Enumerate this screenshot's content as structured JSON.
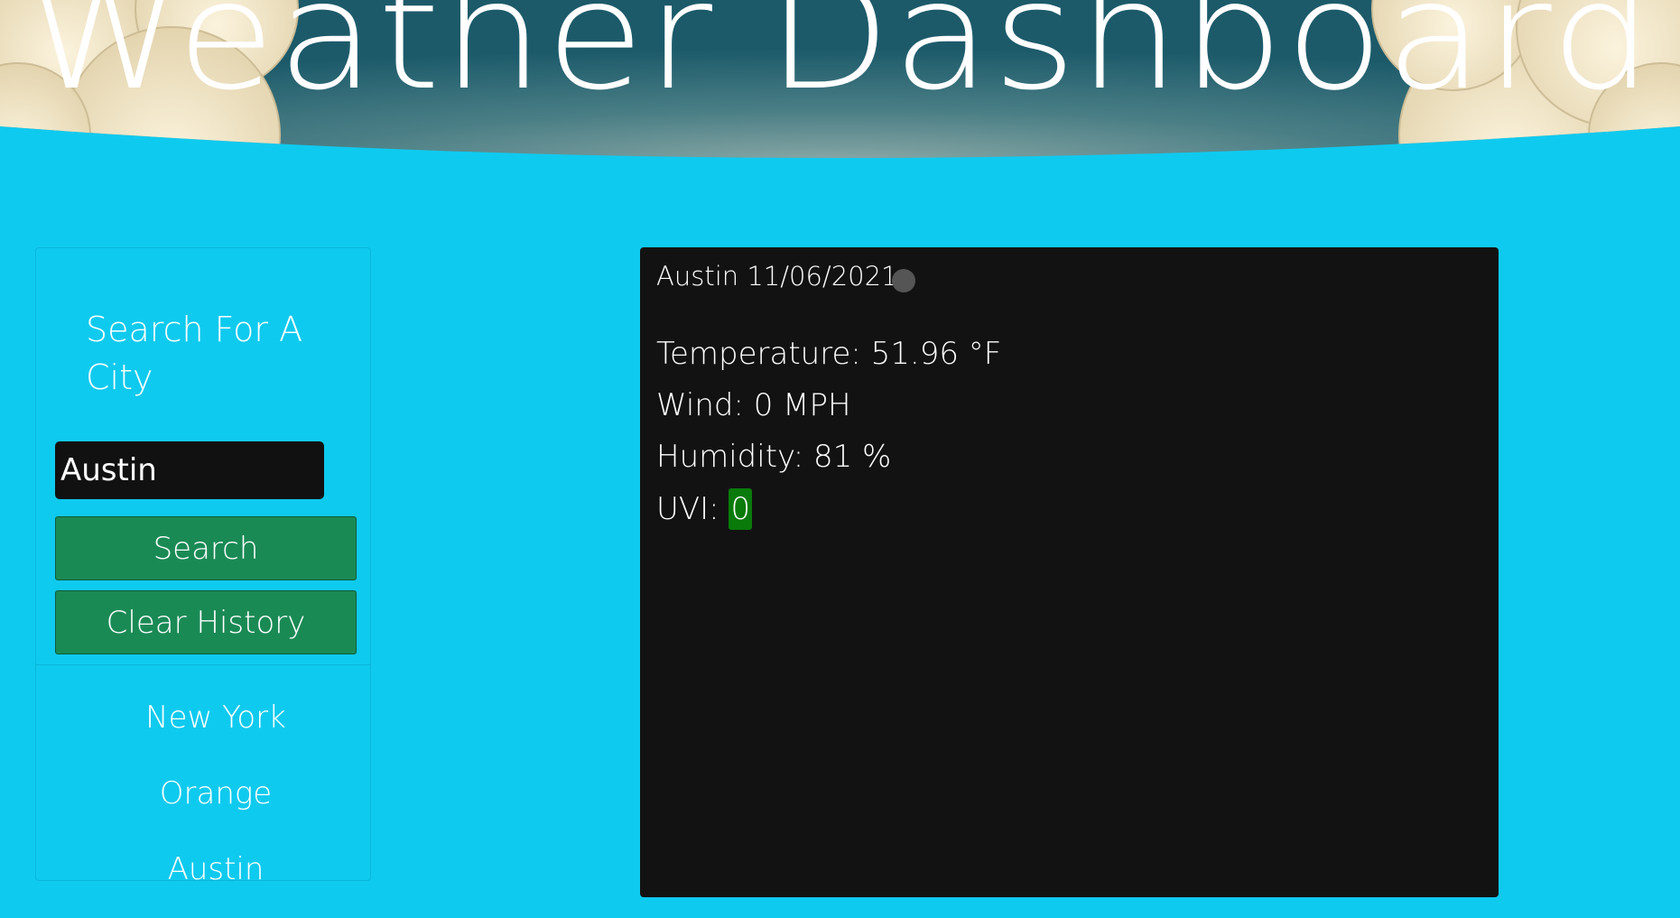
{
  "header": {
    "title": "Weather Dashboard"
  },
  "sidebar": {
    "heading": "Search For A City",
    "input_value": "Austin",
    "search_label": "Search",
    "clear_label": "Clear History",
    "history": [
      "New York",
      "Orange",
      "Austin"
    ]
  },
  "current": {
    "title": "Austin 11/06/2021",
    "temperature": "Temperature: 51.96 °F",
    "wind": "Wind: 0 MPH",
    "humidity": "Humidity: 81 %",
    "uvi_label": "UVI: ",
    "uvi_value": "0",
    "icon": "weather-icon"
  },
  "colors": {
    "page_bg": "#0fcaef",
    "button": "#1a8a55",
    "card": "#121212",
    "uvi_low": "#0a7a0a"
  }
}
